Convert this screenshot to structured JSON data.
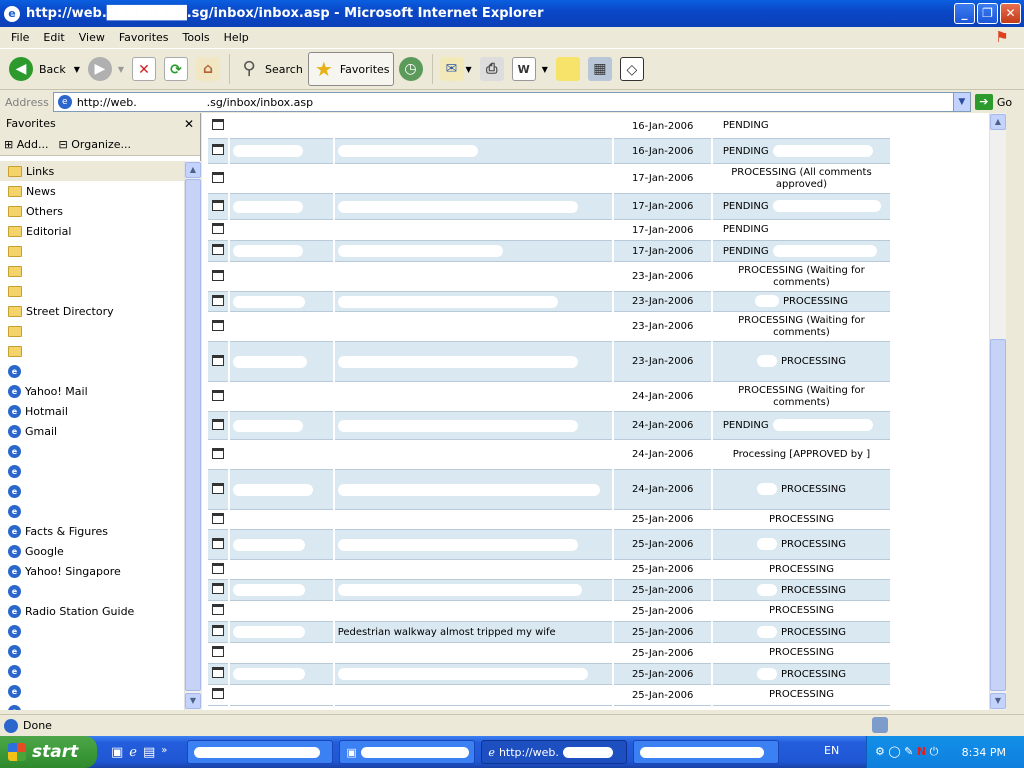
{
  "window": {
    "title": "http://web.████████.sg/inbox/inbox.asp - Microsoft Internet Explorer"
  },
  "menu": [
    "File",
    "Edit",
    "View",
    "Favorites",
    "Tools",
    "Help"
  ],
  "toolbar": {
    "back": "Back",
    "search": "Search",
    "favorites": "Favorites"
  },
  "address": {
    "label": "Address",
    "url": "http://web.                    .sg/inbox/inbox.asp",
    "go": "Go"
  },
  "favorites": {
    "title": "Favorites",
    "add": "Add...",
    "organize": "Organize...",
    "items": [
      {
        "label": "Links",
        "kind": "folder"
      },
      {
        "label": "News",
        "kind": "folder"
      },
      {
        "label": "Others",
        "kind": "folder"
      },
      {
        "label": "Editorial",
        "kind": "folder"
      },
      {
        "label": "",
        "kind": "folder"
      },
      {
        "label": "",
        "kind": "folder"
      },
      {
        "label": "",
        "kind": "folder"
      },
      {
        "label": "Street Directory",
        "kind": "folder"
      },
      {
        "label": "",
        "kind": "folder"
      },
      {
        "label": "",
        "kind": "folder"
      },
      {
        "label": "",
        "kind": "page"
      },
      {
        "label": "Yahoo! Mail",
        "kind": "page"
      },
      {
        "label": "Hotmail",
        "kind": "page"
      },
      {
        "label": "Gmail",
        "kind": "page"
      },
      {
        "label": "",
        "kind": "page"
      },
      {
        "label": "",
        "kind": "page"
      },
      {
        "label": "",
        "kind": "page"
      },
      {
        "label": "",
        "kind": "page"
      },
      {
        "label": "Facts & Figures",
        "kind": "page"
      },
      {
        "label": "Google",
        "kind": "page"
      },
      {
        "label": "Yahoo! Singapore",
        "kind": "page"
      },
      {
        "label": "",
        "kind": "page"
      },
      {
        "label": "Radio Station Guide",
        "kind": "page"
      },
      {
        "label": "",
        "kind": "page"
      },
      {
        "label": "",
        "kind": "page"
      },
      {
        "label": "",
        "kind": "page"
      },
      {
        "label": "",
        "kind": "page"
      },
      {
        "label": "",
        "kind": "page"
      }
    ]
  },
  "inbox": {
    "rows": [
      {
        "date": "16-Jan-2006",
        "status": "PENDING",
        "desc": "",
        "redact_a": 0,
        "redact_b": 0,
        "redact_s": 0,
        "alt": false
      },
      {
        "date": "16-Jan-2006",
        "status": "PENDING",
        "desc": "",
        "redact_a": 70,
        "redact_b": 140,
        "redact_s": 100,
        "alt": true
      },
      {
        "date": "17-Jan-2006",
        "status": "PROCESSING (All comments approved)",
        "desc": "",
        "redact_a": 0,
        "redact_b": 0,
        "redact_s": 0,
        "alt": false,
        "h": 30
      },
      {
        "date": "17-Jan-2006",
        "status": "PENDING",
        "desc": "",
        "redact_a": 70,
        "redact_b": 240,
        "redact_s": 108,
        "alt": true,
        "h": 26
      },
      {
        "date": "17-Jan-2006",
        "status": "PENDING",
        "desc": "",
        "redact_a": 0,
        "redact_b": 0,
        "redact_s": 0,
        "alt": false,
        "h": 21
      },
      {
        "date": "17-Jan-2006",
        "status": "PENDING",
        "desc": "",
        "redact_a": 70,
        "redact_b": 165,
        "redact_s": 104,
        "alt": true,
        "h": 21
      },
      {
        "date": "23-Jan-2006",
        "status": "PROCESSING (Waiting for comments)",
        "desc": "",
        "redact_a": 0,
        "redact_b": 0,
        "redact_s": 0,
        "alt": false,
        "h": 30
      },
      {
        "date": "23-Jan-2006",
        "status": "PROCESSING",
        "desc": "",
        "redact_a": 72,
        "redact_b": 220,
        "redact_s": 24,
        "alt": true,
        "h": 20
      },
      {
        "date": "23-Jan-2006",
        "status": "PROCESSING (Waiting for comments)",
        "desc": "",
        "redact_a": 0,
        "redact_b": 0,
        "redact_s": 0,
        "alt": false,
        "h": 30
      },
      {
        "date": "23-Jan-2006",
        "status": "PROCESSING",
        "desc": "",
        "redact_a": 74,
        "redact_b": 240,
        "redact_s": 20,
        "alt": true,
        "h": 40
      },
      {
        "date": "24-Jan-2006",
        "status": "PROCESSING (Waiting for comments)",
        "desc": "",
        "redact_a": 0,
        "redact_b": 0,
        "redact_s": 0,
        "alt": false,
        "h": 30
      },
      {
        "date": "24-Jan-2006",
        "status": "PENDING",
        "desc": "",
        "redact_a": 70,
        "redact_b": 240,
        "redact_s": 100,
        "alt": true,
        "h": 28
      },
      {
        "date": "24-Jan-2006",
        "status": "Processing [APPROVED by ]",
        "desc": "",
        "redact_a": 0,
        "redact_b": 0,
        "redact_s": 0,
        "alt": false,
        "h": 30
      },
      {
        "date": "24-Jan-2006",
        "status": "PROCESSING",
        "desc": "",
        "redact_a": 80,
        "redact_b": 262,
        "redact_s": 20,
        "alt": true,
        "h": 40
      },
      {
        "date": "25-Jan-2006",
        "status": "PROCESSING",
        "desc": "",
        "redact_a": 0,
        "redact_b": 0,
        "redact_s": 0,
        "alt": false,
        "h": 20
      },
      {
        "date": "25-Jan-2006",
        "status": "PROCESSING",
        "desc": "",
        "redact_a": 72,
        "redact_b": 240,
        "redact_s": 20,
        "alt": true,
        "h": 30
      },
      {
        "date": "25-Jan-2006",
        "status": "PROCESSING",
        "desc": "",
        "redact_a": 0,
        "redact_b": 0,
        "redact_s": 0,
        "alt": false,
        "h": 20
      },
      {
        "date": "25-Jan-2006",
        "status": "PROCESSING",
        "desc": "",
        "redact_a": 72,
        "redact_b": 244,
        "redact_s": 20,
        "alt": true,
        "h": 21
      },
      {
        "date": "25-Jan-2006",
        "status": "PROCESSING",
        "desc": "",
        "redact_a": 0,
        "redact_b": 0,
        "redact_s": 0,
        "alt": false,
        "h": 21
      },
      {
        "date": "25-Jan-2006",
        "status": "PROCESSING",
        "desc": "Pedestrian walkway almost tripped my wife",
        "redact_a": 72,
        "redact_b": 0,
        "redact_s": 20,
        "alt": true,
        "h": 21
      },
      {
        "date": "25-Jan-2006",
        "status": "PROCESSING",
        "desc": "",
        "redact_a": 0,
        "redact_b": 0,
        "redact_s": 0,
        "alt": false,
        "h": 21
      },
      {
        "date": "25-Jan-2006",
        "status": "PROCESSING",
        "desc": "",
        "redact_a": 72,
        "redact_b": 250,
        "redact_s": 20,
        "alt": true,
        "h": 21
      },
      {
        "date": "25-Jan-2006",
        "status": "PROCESSING",
        "desc": "",
        "redact_a": 0,
        "redact_b": 0,
        "redact_s": 0,
        "alt": false,
        "h": 21
      }
    ]
  },
  "status": {
    "text": "Done"
  },
  "taskbar": {
    "start": "start",
    "active_task": "http://web.",
    "lang": "EN",
    "clock": "8:34 PM"
  }
}
